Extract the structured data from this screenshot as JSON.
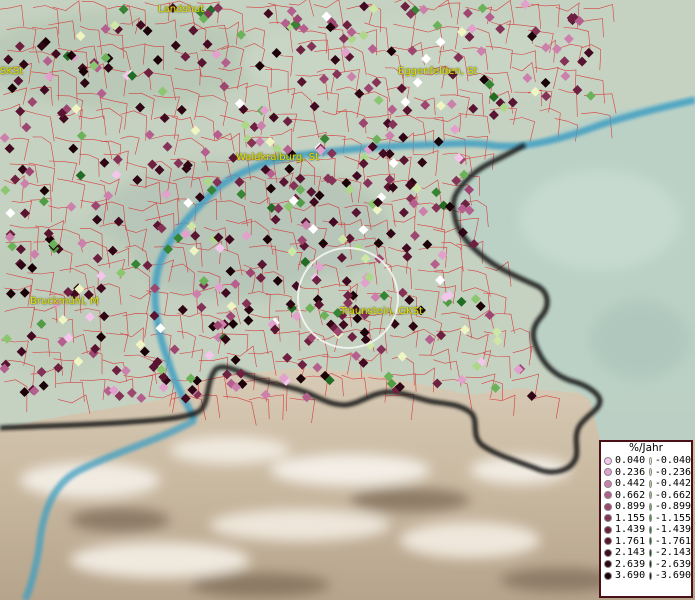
{
  "map": {
    "cities": [
      {
        "id": "landshut",
        "label": "Landshut"
      },
      {
        "id": "sk-left",
        "label": "SKSt"
      },
      {
        "id": "eggenfelden",
        "label": "Eggenfelden, St"
      },
      {
        "id": "waldkraiburg",
        "label": "Waldkraiburg, St"
      },
      {
        "id": "bruckmuehl",
        "label": "Bruckmühl, M"
      },
      {
        "id": "traunstein",
        "label": "Traunstein, GKSt"
      }
    ]
  },
  "legend": {
    "title": "%/Jahr",
    "positive": [
      {
        "label": "0.040",
        "color": "#f3c6ec"
      },
      {
        "label": "0.236",
        "color": "#e2a0cc"
      },
      {
        "label": "0.442",
        "color": "#cc80ac"
      },
      {
        "label": "0.662",
        "color": "#b45f8d"
      },
      {
        "label": "0.899",
        "color": "#9c4670"
      },
      {
        "label": "1.155",
        "color": "#853257"
      },
      {
        "label": "1.439",
        "color": "#6e2040"
      },
      {
        "label": "1.761",
        "color": "#581430"
      },
      {
        "label": "2.143",
        "color": "#420a20"
      },
      {
        "label": "2.639",
        "color": "#2e0614"
      },
      {
        "label": "3.690",
        "color": "#1a0208"
      }
    ],
    "negative": [
      {
        "label": "-0.040",
        "color": "#eef5c2"
      },
      {
        "label": "-0.236",
        "color": "#cfe7a6"
      },
      {
        "label": "-0.442",
        "color": "#add88a"
      },
      {
        "label": "-0.662",
        "color": "#8cc670"
      },
      {
        "label": "-0.899",
        "color": "#6cb25a"
      },
      {
        "label": "-1.155",
        "color": "#4f9c45"
      },
      {
        "label": "-1.439",
        "color": "#368434"
      },
      {
        "label": "-1.761",
        "color": "#226c25"
      },
      {
        "label": "-2.143",
        "color": "#145618"
      },
      {
        "label": "-2.639",
        "color": "#0b4010"
      },
      {
        "label": "-3.690",
        "color": "#052a08"
      }
    ]
  }
}
